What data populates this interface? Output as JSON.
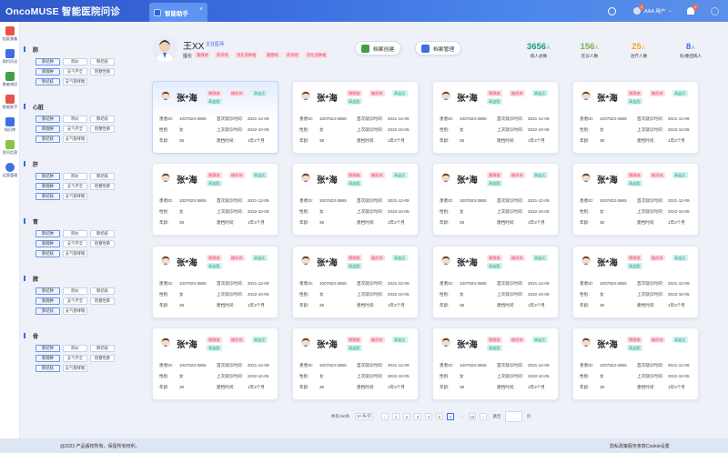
{
  "app": {
    "title": "OncoMUSE 智能医院问诊",
    "tab_label": "智能助手",
    "tab_close": "×",
    "user_name": "AAA 用户",
    "user_badge": "1",
    "bell_badge": "1",
    "chevron": "⌄"
  },
  "leftnav": [
    {
      "label": "档案查看",
      "icon": "calendar-grid-icon",
      "color": "#e5534b"
    },
    {
      "label": "预约问诊",
      "icon": "phone-book-icon",
      "color": "#3f6fe0"
    },
    {
      "label": "患者病历",
      "icon": "medical-file-icon",
      "color": "#43a047"
    },
    {
      "label": "智能助手",
      "icon": "assistant-icon",
      "color": "#e5534b"
    },
    {
      "label": "知识库",
      "icon": "knowledge-icon",
      "color": "#3f6fe0"
    },
    {
      "label": "资讯信息",
      "icon": "news-icon",
      "color": "#8bc34a"
    },
    {
      "label": "运营管理",
      "icon": "network-icon",
      "color": "#3f6fe0"
    }
  ],
  "filters": [
    {
      "organ": "肺",
      "chips": [
        "肺结肿",
        "肺炎",
        "肺结核",
        "肺腺肿",
        "支气不全",
        "阻塞性肺",
        "肺结核",
        "支气管哮喘"
      ]
    },
    {
      "organ": "心脏",
      "chips": [
        "肺结肿",
        "肺炎",
        "肺结核",
        "肺腺肿",
        "支气不全",
        "阻塞性肺",
        "肺结核",
        "支气管哮喘"
      ]
    },
    {
      "organ": "肝",
      "chips": [
        "肺结肿",
        "肺炎",
        "肺结核",
        "肺腺肿",
        "支气不全",
        "阻塞性肺",
        "肺结核",
        "支气管哮喘"
      ]
    },
    {
      "organ": "胃",
      "chips": [
        "肺结肿",
        "肺炎",
        "肺结核",
        "肺腺肿",
        "支气不全",
        "阻塞性肺",
        "肺结核",
        "支气管哮喘"
      ]
    },
    {
      "organ": "脾",
      "chips": [
        "肺结肿",
        "肺炎",
        "肺结核",
        "肺腺肿",
        "支气不全",
        "阻塞性肺",
        "肺结核",
        "支气管哮喘"
      ]
    },
    {
      "organ": "骨",
      "chips": [
        "肺结肿",
        "肺炎",
        "肺结核",
        "肺腺肿",
        "支气不全",
        "阻塞性肺",
        "肺结核",
        "支气管哮喘"
      ]
    }
  ],
  "doctor": {
    "name": "王XX",
    "title": "主任医师",
    "role_label": "擅长",
    "tags": [
      "胰腺癌",
      "肝部癌",
      "消化道肿瘤",
      "胰腺癌",
      "肝部癌",
      "消化道肿瘤"
    ]
  },
  "actions": {
    "create": "档案创建",
    "manage": "档案管理"
  },
  "stats": [
    {
      "value": "3656",
      "unit": "人",
      "label": "病人总数",
      "color": "#1a9c84"
    },
    {
      "value": "156",
      "unit": "人",
      "label": "在诊人数",
      "color": "#7cb342"
    },
    {
      "value": "25",
      "unit": "人",
      "label": "治疗人数",
      "color": "#f5a623"
    },
    {
      "value": "8",
      "unit": "人",
      "label": "危/重症病人",
      "color": "#3f6fe0"
    }
  ],
  "card": {
    "name": "张*海",
    "tags": [
      "胰腺癌",
      "糖尿病",
      "高血压",
      "高血脂"
    ],
    "id_label": "患者ID:",
    "id_value": "1007823-3865",
    "first_label": "首次就诊时间:",
    "first_value": "2021-12-09",
    "gender_label": "性别:",
    "gender_value": "女",
    "last_label": "上次就诊时间:",
    "last_value": "2022-10-05",
    "age_label": "年龄:",
    "age_value": "38",
    "dur_label": "建档时间:",
    "dur_value": "1年3个月"
  },
  "pagination": {
    "total": "共有150条",
    "page_size": "10 条/页",
    "prev": "‹",
    "pages": [
      "1",
      "2",
      "3",
      "4",
      "5",
      "6",
      "···",
      "16"
    ],
    "active_page": "6",
    "next": "›",
    "goto_label": "跳至",
    "goto_suffix": "页"
  },
  "footer": {
    "copyright": "@2023 产品版权所有，保留所有权利。",
    "links": "隐私政策服务条款Cookie设置"
  }
}
